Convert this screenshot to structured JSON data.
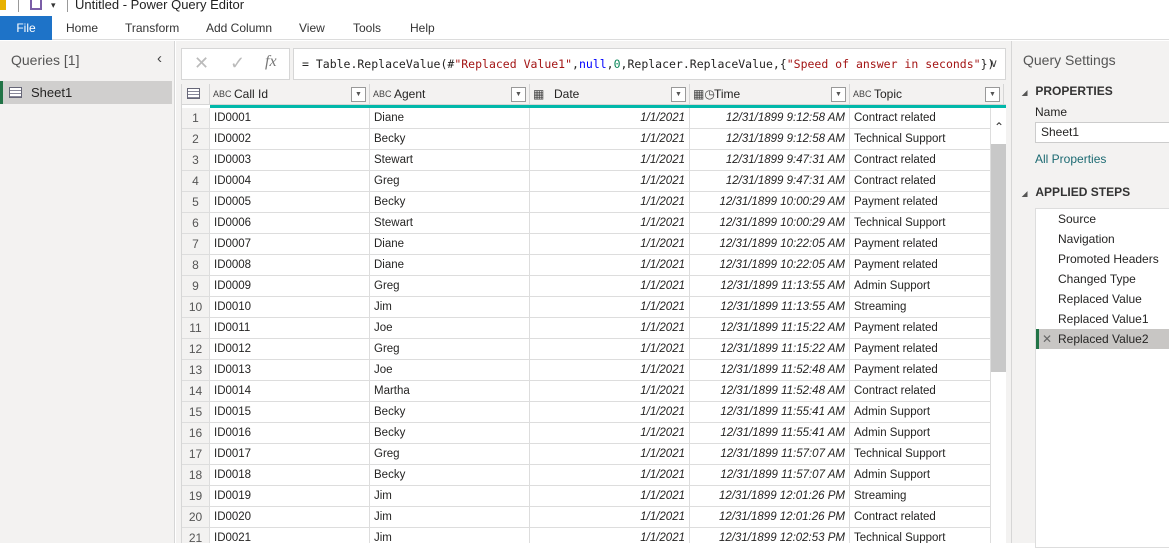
{
  "window": {
    "title": "Untitled - Power Query Editor"
  },
  "ribbon": {
    "tabs": [
      "File",
      "Home",
      "Transform",
      "Add Column",
      "View",
      "Tools",
      "Help"
    ]
  },
  "queries": {
    "header": "Queries [1]",
    "items": [
      {
        "label": "Sheet1",
        "selected": true
      }
    ]
  },
  "formula": {
    "prefix": "= Table.ReplaceValue(#",
    "string1": "\"Replaced Value1\"",
    "c1": ",",
    "kw": "null",
    "c2": ",",
    "num": "0",
    "mid": ",Replacer.ReplaceValue,{",
    "string2": "\"Speed of answer in seconds\"",
    "end": "})",
    "cancel_icon": "✕",
    "commit_icon": "✓",
    "fx_label": "fx"
  },
  "table": {
    "columns": [
      {
        "name": "Call Id",
        "type": "ABC"
      },
      {
        "name": "Agent",
        "type": "ABC"
      },
      {
        "name": "Date",
        "type": "date"
      },
      {
        "name": "Time",
        "type": "datetime"
      },
      {
        "name": "Topic",
        "type": "ABC"
      }
    ],
    "rows": [
      [
        "ID0001",
        "Diane",
        "1/1/2021",
        "12/31/1899 9:12:58 AM",
        "Contract related"
      ],
      [
        "ID0002",
        "Becky",
        "1/1/2021",
        "12/31/1899 9:12:58 AM",
        "Technical Support"
      ],
      [
        "ID0003",
        "Stewart",
        "1/1/2021",
        "12/31/1899 9:47:31 AM",
        "Contract related"
      ],
      [
        "ID0004",
        "Greg",
        "1/1/2021",
        "12/31/1899 9:47:31 AM",
        "Contract related"
      ],
      [
        "ID0005",
        "Becky",
        "1/1/2021",
        "12/31/1899 10:00:29 AM",
        "Payment related"
      ],
      [
        "ID0006",
        "Stewart",
        "1/1/2021",
        "12/31/1899 10:00:29 AM",
        "Technical Support"
      ],
      [
        "ID0007",
        "Diane",
        "1/1/2021",
        "12/31/1899 10:22:05 AM",
        "Payment related"
      ],
      [
        "ID0008",
        "Diane",
        "1/1/2021",
        "12/31/1899 10:22:05 AM",
        "Payment related"
      ],
      [
        "ID0009",
        "Greg",
        "1/1/2021",
        "12/31/1899 11:13:55 AM",
        "Admin Support"
      ],
      [
        "ID0010",
        "Jim",
        "1/1/2021",
        "12/31/1899 11:13:55 AM",
        "Streaming"
      ],
      [
        "ID0011",
        "Joe",
        "1/1/2021",
        "12/31/1899 11:15:22 AM",
        "Payment related"
      ],
      [
        "ID0012",
        "Greg",
        "1/1/2021",
        "12/31/1899 11:15:22 AM",
        "Payment related"
      ],
      [
        "ID0013",
        "Joe",
        "1/1/2021",
        "12/31/1899 11:52:48 AM",
        "Payment related"
      ],
      [
        "ID0014",
        "Martha",
        "1/1/2021",
        "12/31/1899 11:52:48 AM",
        "Contract related"
      ],
      [
        "ID0015",
        "Becky",
        "1/1/2021",
        "12/31/1899 11:55:41 AM",
        "Admin Support"
      ],
      [
        "ID0016",
        "Becky",
        "1/1/2021",
        "12/31/1899 11:55:41 AM",
        "Admin Support"
      ],
      [
        "ID0017",
        "Greg",
        "1/1/2021",
        "12/31/1899 11:57:07 AM",
        "Technical Support"
      ],
      [
        "ID0018",
        "Becky",
        "1/1/2021",
        "12/31/1899 11:57:07 AM",
        "Admin Support"
      ],
      [
        "ID0019",
        "Jim",
        "1/1/2021",
        "12/31/1899 12:01:26 PM",
        "Streaming"
      ],
      [
        "ID0020",
        "Jim",
        "1/1/2021",
        "12/31/1899 12:01:26 PM",
        "Contract related"
      ],
      [
        "ID0021",
        "Jim",
        "1/1/2021",
        "12/31/1899 12:02:53 PM",
        "Technical Support"
      ]
    ]
  },
  "settings": {
    "title": "Query Settings",
    "properties_label": "PROPERTIES",
    "name_label": "Name",
    "name_value": "Sheet1",
    "all_properties": "All Properties",
    "applied_steps_label": "APPLIED STEPS",
    "steps": [
      "Source",
      "Navigation",
      "Promoted Headers",
      "Changed Type",
      "Replaced Value",
      "Replaced Value1",
      "Replaced Value2"
    ],
    "selected_step": "Replaced Value2"
  },
  "colors": {
    "accent": "#1e73c8",
    "teal": "#01b8aa",
    "selected_green": "#217346",
    "string": "#a31515",
    "keyword": "#0000ff",
    "number": "#098658"
  }
}
